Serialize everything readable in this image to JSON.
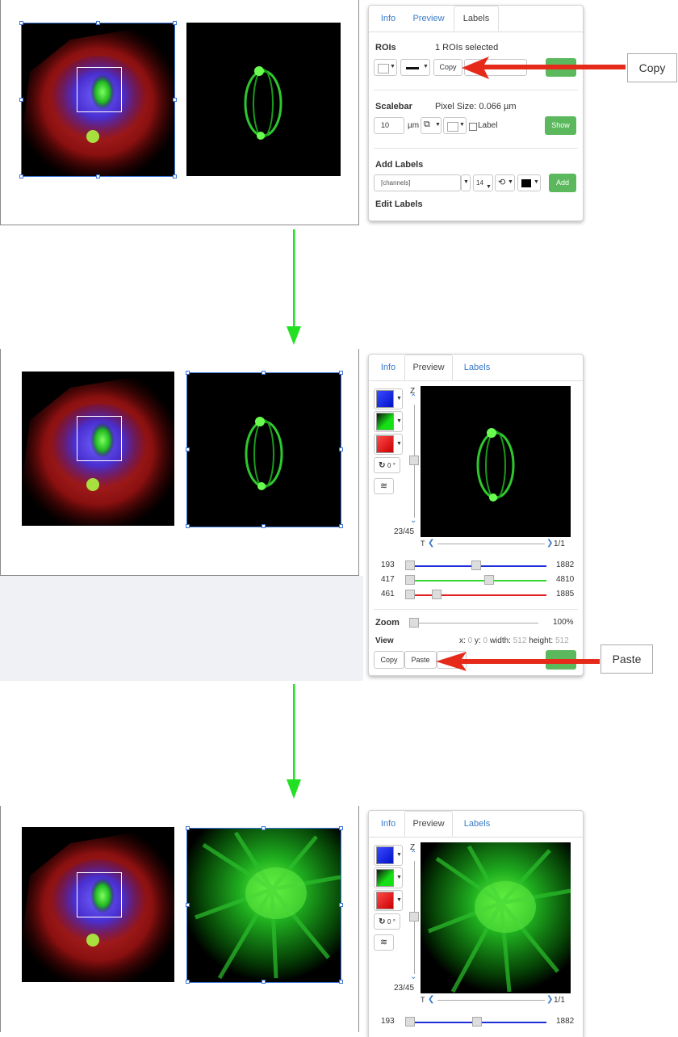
{
  "tabs": {
    "info": "Info",
    "preview": "Preview",
    "labels": "Labels"
  },
  "step1": {
    "rois_label": "ROIs",
    "rois_selected": "1 ROIs selected",
    "copy_label": "Copy",
    "scalebar_label": "Scalebar",
    "pixel_size": "Pixel Size: 0.066 µm",
    "scalebar_value": "10",
    "unit": "µm",
    "label_checkbox": "Label",
    "show_button": "Show",
    "add_labels": "Add Labels",
    "channels_value": "[channels]",
    "font_size": "14",
    "add_button": "Add",
    "edit_labels": "Edit Labels",
    "callout": "Copy"
  },
  "step2": {
    "z_label": "Z",
    "z_position": "23/45",
    "t_label": "T",
    "t_position": "1/1",
    "rotation": "0 °",
    "channels": [
      {
        "min": "193",
        "max": "1882",
        "color": "#1f2ed8",
        "start": 0.0,
        "end": 0.5
      },
      {
        "min": "417",
        "max": "4810",
        "color": "#2ed82e",
        "start": 0.0,
        "end": 0.6
      },
      {
        "min": "461",
        "max": "1885",
        "color": "#e02020",
        "start": 0.0,
        "end": 0.2
      }
    ],
    "zoom_label": "Zoom",
    "zoom_value": "100%",
    "view_label": "View",
    "view_x_label": "x:",
    "view_x": "0",
    "view_y_label": "y:",
    "view_y": "0",
    "view_w_label": "width:",
    "view_w": "512",
    "view_h_label": "height:",
    "view_h": "512",
    "copy_button": "Copy",
    "paste_button": "Paste",
    "callout": "Paste"
  },
  "step3": {
    "z_label": "Z",
    "z_position": "23/45",
    "t_label": "T",
    "t_position": "1/1",
    "rotation": "0 °",
    "ch1_min": "193",
    "ch1_max": "1882"
  },
  "colors": {
    "accent_green_arrow": "#22e022",
    "pointer_red": "#e52a1a",
    "selection_blue": "#3a74d8",
    "success_green": "#5cb85c"
  }
}
